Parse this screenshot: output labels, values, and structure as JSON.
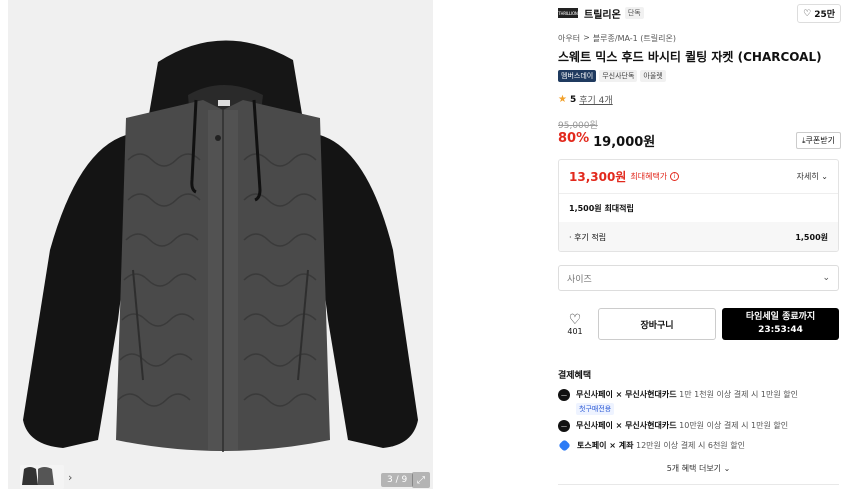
{
  "gallery": {
    "counter": "3 / 9",
    "expand_icon": "expand-icon",
    "thumb_arrow": "›"
  },
  "brand": {
    "logo_text": "THRILLION",
    "name": "트릴리온",
    "tag": "단독",
    "likes": "25만"
  },
  "breadcrumb": [
    "아우터",
    ">",
    "블루종/MA-1 (트릴리온)"
  ],
  "product": {
    "title": "스웨트 믹스 후드 바시티 퀼팅 자켓 (CHARCOAL)",
    "badges": [
      "멤버스데이",
      "무신사단독",
      "아울렛"
    ],
    "rating": "5",
    "reviews": "후기 4개",
    "original_price": "95,000원",
    "discount": "80%",
    "price": "19,000원",
    "coupon_label": "쿠폰받기"
  },
  "benefit": {
    "max_price": "13,300원",
    "max_label": "최대혜택가",
    "detail_label": "자세히",
    "points_title": "1,500원 최대적립",
    "review_points_label": "· 후기 적립",
    "review_points_value": "1,500원"
  },
  "size_select": {
    "placeholder": "사이즈"
  },
  "actions": {
    "wish_count": "401",
    "cart_label": "장바구니",
    "buy_line1": "타임세일 종료까지",
    "buy_line2": "23:53:44"
  },
  "payment": {
    "title": "결제혜택",
    "items": [
      {
        "name": "무신사페이 × 무신사현대카드",
        "desc": "1만 1천원 이상 결제 시 1만원 할인",
        "chip": "첫구매전용"
      },
      {
        "name": "무신사페이 × 무신사현대카드",
        "desc": "10만원 이상 결제 시 1만원 할인"
      },
      {
        "name": "토스페이 × 계좌",
        "desc": "12만원 이상 결제 시 6천원 할인"
      }
    ],
    "more": "5개 혜택 더보기"
  },
  "colors": {
    "accent_red": "#e2291d",
    "member_badge": "#1f3a5f",
    "toss_blue": "#2e7cf6"
  }
}
